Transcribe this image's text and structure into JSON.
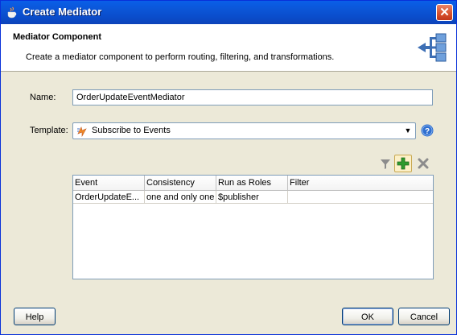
{
  "window": {
    "title": "Create Mediator"
  },
  "header": {
    "title": "Mediator Component",
    "description": "Create a mediator component to perform routing, filtering, and transformations."
  },
  "form": {
    "name_label": "Name:",
    "name_value": "OrderUpdateEventMediator",
    "template_label": "Template:",
    "template_value": "Subscribe to Events"
  },
  "table": {
    "columns": [
      "Event",
      "Consistency",
      "Run as Roles",
      "Filter"
    ],
    "rows": [
      [
        "OrderUpdateE...",
        "one and only one",
        "$publisher",
        ""
      ]
    ]
  },
  "buttons": {
    "help": "Help",
    "ok": "OK",
    "cancel": "Cancel"
  },
  "icons": {
    "title": "java-cup-icon",
    "header": "mediator-routing-icon",
    "template": "lightning-event-icon",
    "help": "help-icon",
    "filter": "filter-icon",
    "add": "add-icon",
    "delete": "delete-icon"
  },
  "colors": {
    "title_bar": "#0a55d6",
    "add_icon": "#2e9a2e",
    "help_icon": "#2f6fd0"
  }
}
